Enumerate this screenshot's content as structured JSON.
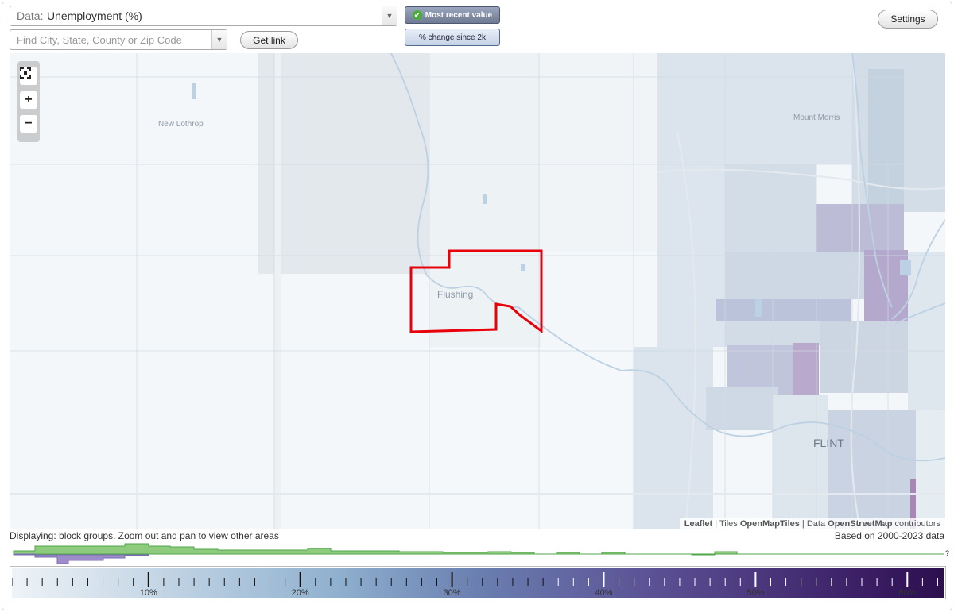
{
  "controls": {
    "data_prefix": "Data:",
    "data_value": "Unemployment (%)",
    "search_placeholder": "Find City, State, County or Zip Code",
    "get_link": "Get link",
    "toggle_recent": "Most recent value",
    "toggle_change": "% change since 2k",
    "settings": "Settings"
  },
  "map": {
    "labels": {
      "new_lothrop": "New Lothrop",
      "mount_morris": "Mount Morris",
      "flushing": "Flushing",
      "flint": "FLINT"
    },
    "zoom": {
      "fit": "fit-icon",
      "in": "+",
      "out": "−"
    },
    "attribution": {
      "leaflet": "Leaflet",
      "tiles_prefix": "Tiles",
      "tiles": "OpenMapTiles",
      "data_prefix": "Data",
      "data": "OpenStreetMap",
      "suffix": "contributors"
    },
    "highlight_color": "#e8000b"
  },
  "footer": {
    "displaying": "Displaying: block groups. Zoom out and pan to view other areas",
    "based_on": "Based on 2000-2023 data",
    "histogram_question": "?"
  },
  "legend": {
    "tick_labels": [
      "10%",
      "20%",
      "30%",
      "40%",
      "50%",
      "60%"
    ],
    "tick_values": [
      10,
      20,
      30,
      40,
      50,
      60
    ],
    "range": [
      1,
      62.5
    ],
    "colors": {
      "low": "#eef3f7",
      "mid": "#6a7fb0",
      "high": "#2b0f4d"
    }
  }
}
